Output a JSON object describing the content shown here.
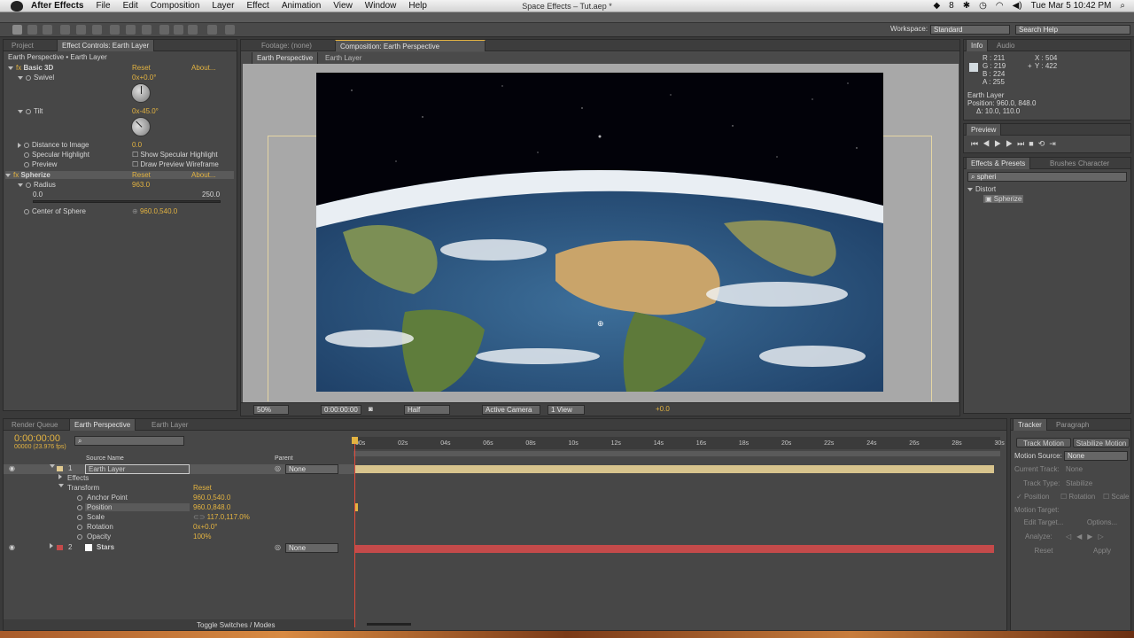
{
  "menubar": {
    "app_name": "After Effects",
    "items": [
      "File",
      "Edit",
      "Composition",
      "Layer",
      "Effect",
      "Animation",
      "View",
      "Window",
      "Help"
    ],
    "window_title": "Space Effects – Tut.aep *",
    "status_icons": [
      "8",
      "icon-dropbox",
      "icon-bluetooth",
      "icon-time-machine",
      "icon-wifi",
      "icon-volume"
    ],
    "clock": "Tue Mar 5  10:42 PM"
  },
  "toolbar": {
    "workspace_label": "Workspace:",
    "workspace_value": "Standard",
    "search_placeholder": "Search Help"
  },
  "project_panel": {
    "tab_project": "Project",
    "tab_effect_controls": "Effect Controls: Earth Layer",
    "breadcrumb": "Earth Perspective • Earth Layer",
    "effects": [
      {
        "name": "Basic 3D",
        "reset": "Reset",
        "about": "About..."
      },
      {
        "name": "Spherize",
        "reset": "Reset",
        "about": "About..."
      }
    ],
    "swivel_label": "Swivel",
    "swivel_value": "0x+0.0°",
    "tilt_label": "Tilt",
    "tilt_value": "0x-45.0°",
    "distance_label": "Distance to Image",
    "distance_value": "0.0",
    "specular_label": "Specular Highlight",
    "specular_check": "Show Specular Highlight",
    "preview_label": "Preview",
    "preview_check": "Draw Preview Wireframe",
    "radius_label": "Radius",
    "radius_value": "963.0",
    "radius_min": "0.0",
    "radius_max": "250.0",
    "center_label": "Center of Sphere",
    "center_value": "960.0,540.0"
  },
  "comp_panel": {
    "tab_footage": "Footage: (none)",
    "tab_comp": "Composition: Earth Perspective",
    "crumb_comp": "Earth Perspective",
    "crumb_layer": "Earth Layer",
    "zoom": "50%",
    "timecode": "0:00:00:00",
    "resolution": "Half",
    "camera": "Active Camera",
    "views": "1 View",
    "exposure": "+0.0"
  },
  "info_panel": {
    "tab_info": "Info",
    "tab_audio": "Audio",
    "r": "R : 211",
    "g": "G : 219",
    "b": "B : 224",
    "a": "A : 255",
    "x": "X : 504",
    "y": "Y : 422",
    "layer": "Earth Layer",
    "position": "Position: 960.0, 848.0",
    "delta": "Δ: 10.0, 110.0"
  },
  "preview_panel": {
    "tab": "Preview"
  },
  "effects_presets": {
    "tab_effects": "Effects & Presets",
    "tab_brushes": "Brushes",
    "tab_character": "Character",
    "search_value": "spheri",
    "category": "Distort",
    "item": "Spherize"
  },
  "timeline": {
    "tab_render": "Render Queue",
    "tab_comp": "Earth Perspective",
    "tab_layer": "Earth Layer",
    "timecode": "0:00:00:00",
    "fps": "00000 (23.976 fps)",
    "col_source": "Source Name",
    "col_parent": "Parent",
    "ruler": [
      "00s",
      "02s",
      "04s",
      "06s",
      "08s",
      "10s",
      "12s",
      "14s",
      "16s",
      "18s",
      "20s",
      "22s",
      "24s",
      "26s",
      "28s",
      "30s"
    ],
    "layers": [
      {
        "num": "1",
        "name": "Earth Layer",
        "parent": "None",
        "color": "#e0c98f"
      },
      {
        "num": "2",
        "name": "Stars",
        "parent": "None",
        "color": "#c44a4a"
      }
    ],
    "effects_label": "Effects",
    "transform_label": "Transform",
    "transform_reset": "Reset",
    "props": [
      {
        "name": "Anchor Point",
        "value": "960.0,540.0"
      },
      {
        "name": "Position",
        "value": "960.0,848.0"
      },
      {
        "name": "Scale",
        "value": "117.0,117.0%"
      },
      {
        "name": "Rotation",
        "value": "0x+0.0°"
      },
      {
        "name": "Opacity",
        "value": "100%"
      }
    ],
    "toggle_label": "Toggle Switches / Modes"
  },
  "tracker": {
    "tab_tracker": "Tracker",
    "tab_paragraph": "Paragraph",
    "track_motion": "Track Motion",
    "stabilize_motion": "Stabilize Motion",
    "motion_source_label": "Motion Source:",
    "motion_source_value": "None",
    "current_track_label": "Current Track:",
    "current_track_value": "None",
    "track_type_label": "Track Type:",
    "track_type_value": "Stabilize",
    "opt_position": "Position",
    "opt_rotation": "Rotation",
    "opt_scale": "Scale",
    "motion_target_label": "Motion Target:",
    "edit_target": "Edit Target...",
    "options": "Options...",
    "analyze_label": "Analyze:",
    "reset": "Reset",
    "apply": "Apply"
  }
}
